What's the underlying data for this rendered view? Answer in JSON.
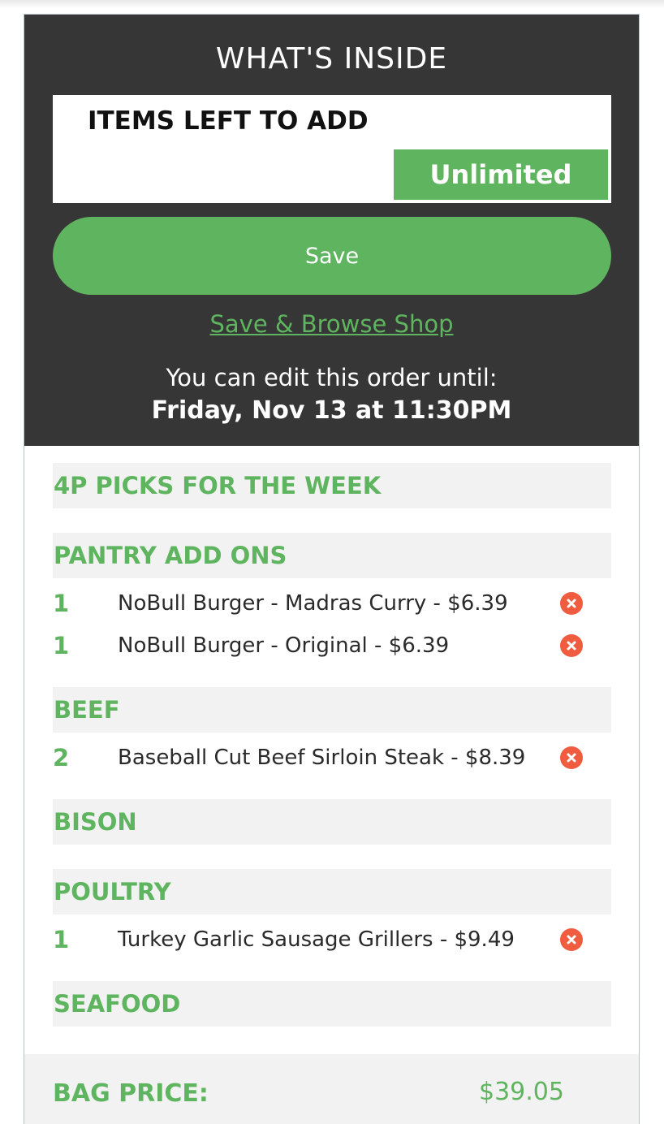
{
  "header": {
    "title": "WHAT'S INSIDE",
    "items_left_label": "ITEMS LEFT TO ADD",
    "items_left_value": "Unlimited",
    "save_label": "Save",
    "browse_label": "Save & Browse Shop",
    "edit_note": "You can edit this order until:",
    "edit_deadline": "Friday, Nov 13 at 11:30PM"
  },
  "categories": {
    "picks": "4P PICKS FOR THE WEEK",
    "pantry": "PANTRY ADD ONS",
    "beef": "BEEF",
    "bison": "BISON",
    "poultry": "POULTRY",
    "seafood": "SEAFOOD"
  },
  "items": {
    "pantry_1": {
      "qty": "1",
      "name": "NoBull Burger - Madras Curry  - $6.39"
    },
    "pantry_2": {
      "qty": "1",
      "name": "NoBull Burger - Original  - $6.39"
    },
    "beef_1": {
      "qty": "2",
      "name": "Baseball Cut Beef Sirloin Steak  - $8.39"
    },
    "poultry_1": {
      "qty": "1",
      "name": "Turkey Garlic Sausage Grillers  - $9.49"
    }
  },
  "footer": {
    "bag_price_label": "BAG PRICE:",
    "bag_price_value": "$39.05"
  },
  "colors": {
    "accent_green": "#5fb55f",
    "header_bg": "#363636",
    "remove_red": "#f05c3f",
    "category_bg": "#f2f2f2"
  },
  "icons": {
    "remove": "close-circle-icon"
  }
}
